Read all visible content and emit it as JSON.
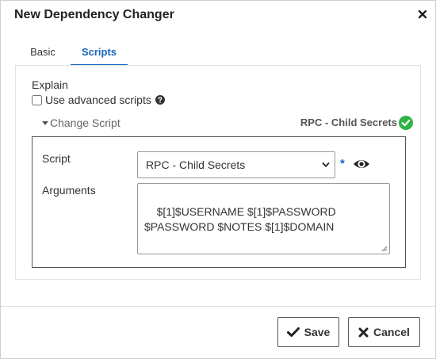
{
  "dialog": {
    "title": "New Dependency Changer",
    "close_icon": "close-icon"
  },
  "tabs": [
    {
      "label": "Basic",
      "active": false
    },
    {
      "label": "Scripts",
      "active": true
    }
  ],
  "explain": {
    "label": "Explain",
    "advanced_label": "Use advanced scripts",
    "advanced_checked": false,
    "help_icon": "question-circle-icon"
  },
  "change_script": {
    "toggle_label": "Change Script",
    "selected_label": "RPC - Child Secrets",
    "status_icon": "check-circle-icon",
    "status_color": "#2fb344"
  },
  "form": {
    "script_label": "Script",
    "script_value": "RPC - Child Secrets",
    "required_mark": "*",
    "view_icon": "eye-icon",
    "arguments_label": "Arguments",
    "arguments_value": "$[1]$USERNAME $[1]$PASSWORD $PASSWORD $NOTES $[1]$DOMAIN"
  },
  "footer": {
    "save_label": "Save",
    "cancel_label": "Cancel"
  },
  "colors": {
    "accent": "#1565c0",
    "border": "#555555"
  }
}
